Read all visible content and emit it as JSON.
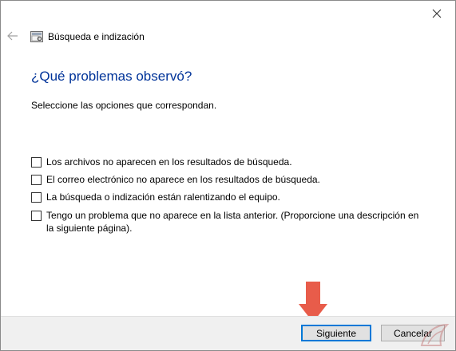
{
  "window": {
    "title": "Búsqueda e indización"
  },
  "icons": {
    "close": "close-icon",
    "back": "back-arrow-icon",
    "app": "search-indexing-icon",
    "pointer_arrow": "red-arrow-icon",
    "watermark": "watermark-logo-icon"
  },
  "colors": {
    "heading": "#003399",
    "accent": "#0078d7",
    "arrow": "#e85c4a"
  },
  "main": {
    "heading": "¿Qué problemas observó?",
    "instructions": "Seleccione las opciones que correspondan.",
    "options": [
      {
        "label": "Los archivos no aparecen en los resultados de búsqueda.",
        "checked": false
      },
      {
        "label": "El correo electrónico no aparece en los resultados de búsqueda.",
        "checked": false
      },
      {
        "label": "La búsqueda o indización están ralentizando el equipo.",
        "checked": false
      },
      {
        "label": "Tengo un problema que no aparece en la lista anterior. (Proporcione una descripción en la siguiente página).",
        "checked": false
      }
    ]
  },
  "footer": {
    "next_label": "Siguiente",
    "cancel_label": "Cancelar"
  }
}
